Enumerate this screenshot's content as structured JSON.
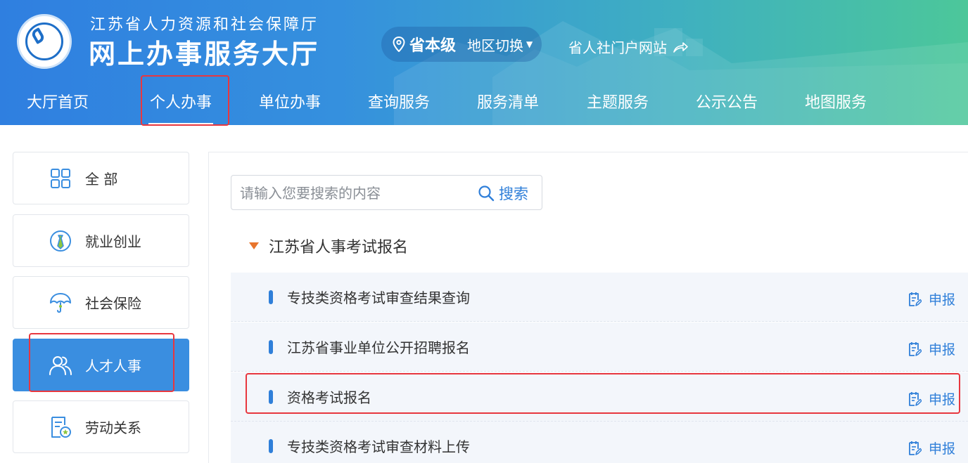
{
  "header": {
    "org_name": "江苏省人力资源和社会保障厅",
    "hall_name": "网上办事服务大厅",
    "region_level": "省本级",
    "region_switch": "地区切换",
    "portal_link": "省人社门户网站"
  },
  "nav": {
    "items": [
      {
        "label": "大厅首页"
      },
      {
        "label": "个人办事"
      },
      {
        "label": "单位办事"
      },
      {
        "label": "查询服务"
      },
      {
        "label": "服务清单"
      },
      {
        "label": "主题服务"
      },
      {
        "label": "公示公告"
      },
      {
        "label": "地图服务"
      }
    ],
    "active": "个人办事"
  },
  "sidebar": {
    "items": [
      {
        "label": "全 部",
        "icon": "grid-icon"
      },
      {
        "label": "就业创业",
        "icon": "tie-icon"
      },
      {
        "label": "社会保险",
        "icon": "umbrella-icon"
      },
      {
        "label": "人才人事",
        "icon": "people-icon"
      },
      {
        "label": "劳动关系",
        "icon": "contract-icon"
      }
    ],
    "active": "人才人事"
  },
  "search": {
    "placeholder": "请输入您要搜索的内容",
    "button_label": "搜索"
  },
  "group": {
    "title": "江苏省人事考试报名",
    "items": [
      {
        "name": "专技类资格考试审查结果查询",
        "action": "申报"
      },
      {
        "name": "江苏省事业单位公开招聘报名",
        "action": "申报"
      },
      {
        "name": "资格考试报名",
        "action": "申报"
      },
      {
        "name": "专技类资格考试审查材料上传",
        "action": "申报"
      }
    ]
  },
  "colors": {
    "primary": "#2f7fd9",
    "active_card": "#3a8ee0",
    "highlight_border": "#e8373f",
    "group_marker": "#e8752d"
  }
}
